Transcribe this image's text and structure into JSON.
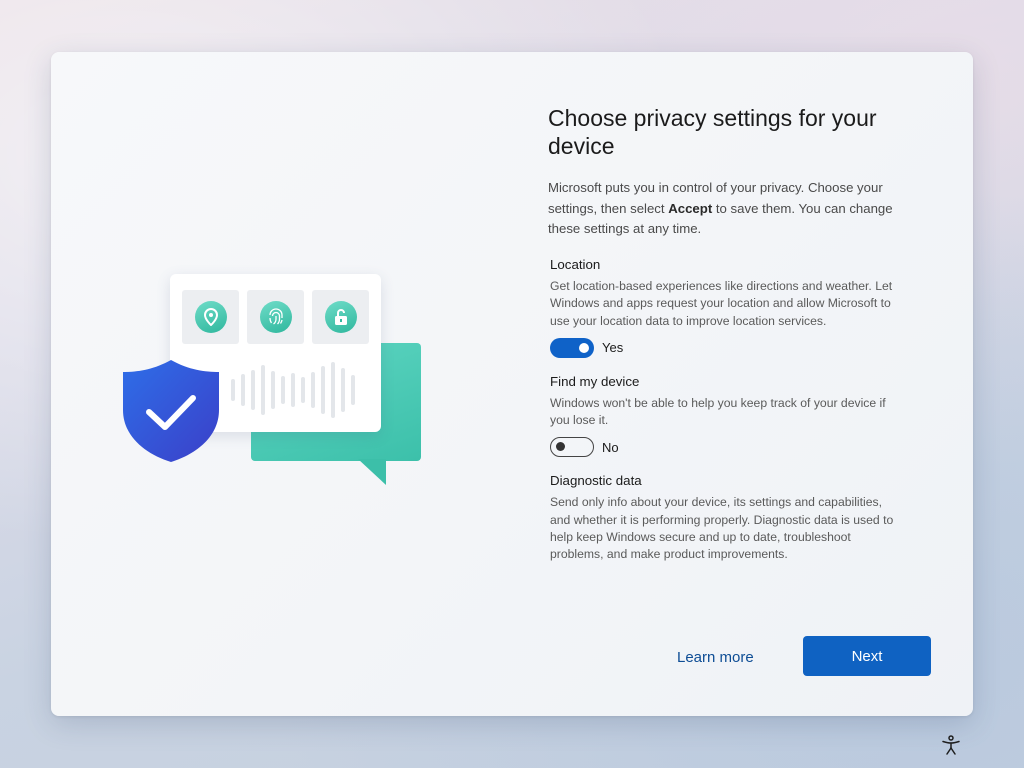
{
  "page": {
    "title": "Choose privacy settings for your device",
    "intro_before": "Microsoft puts you in control of your privacy. Choose your settings, then select ",
    "intro_bold": "Accept",
    "intro_after": " to save them. You can change these settings at any time."
  },
  "settings": [
    {
      "title": "Location",
      "description": "Get location-based experiences like directions and weather. Let Windows and apps request your location and allow Microsoft to use your location data to improve location services.",
      "toggle_state": "on",
      "toggle_label": "Yes"
    },
    {
      "title": "Find my device",
      "description": "Windows won't be able to help you keep track of your device if you lose it.",
      "toggle_state": "off",
      "toggle_label": "No"
    },
    {
      "title": "Diagnostic data",
      "description": "Send only info about your device, its settings and capabilities, and whether it is performing properly. Diagnostic data is used to help keep Windows secure and up to date, troubleshoot problems, and make product improvements."
    }
  ],
  "footer": {
    "learn_more_label": "Learn more",
    "next_label": "Next"
  },
  "icons": {
    "illustration_tiles": [
      "location-pin-icon",
      "fingerprint-icon",
      "unlock-icon"
    ],
    "shield": "shield-check-icon",
    "accessibility": "accessibility-icon"
  },
  "colors": {
    "accent": "#0f62c2",
    "link": "#0e4d95",
    "teal": "#3cc0aa",
    "shield": "#2d55d6"
  }
}
